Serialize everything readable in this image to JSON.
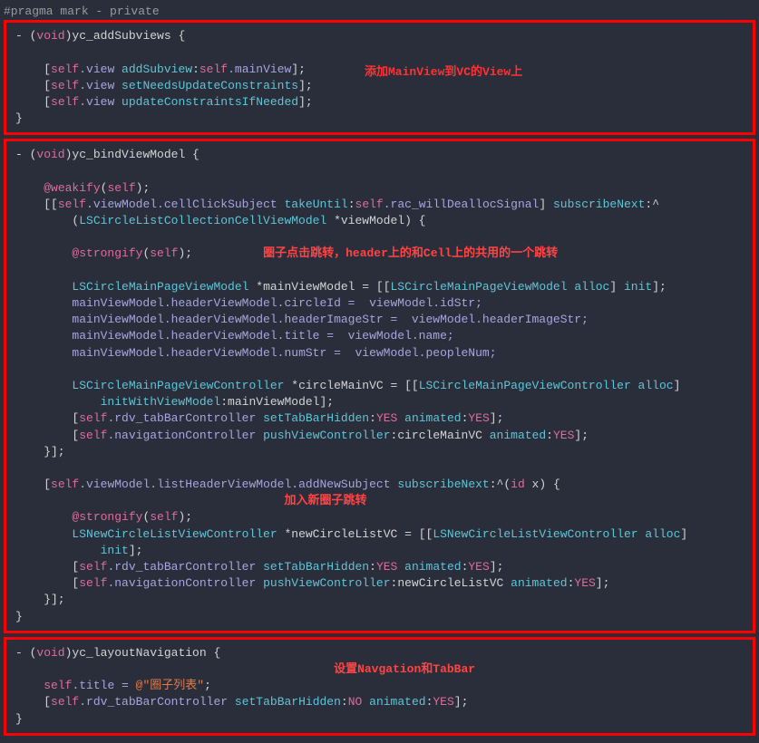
{
  "pragma": "#pragma mark - private",
  "section1": {
    "sig": "- (void)yc_addSubviews {",
    "l1_a": "self",
    "l1_b": ".view ",
    "l1_c": "addSubview",
    "l1_d": ":",
    "l1_e": "self",
    "l1_f": ".mainView",
    "l1_g": "];",
    "l2_a": "self",
    "l2_b": ".view ",
    "l2_c": "setNeedsUpdateConstraints",
    "l2_d": "];",
    "l3_a": "self",
    "l3_b": ".view ",
    "l3_c": "updateConstraintsIfNeeded",
    "l3_d": "];",
    "close": "}",
    "annotation": "添加MainView到VC的View上"
  },
  "section2": {
    "sig": "- (void)yc_bindViewModel {",
    "weak_a": "@weakify",
    "weak_b": "(",
    "weak_c": "self",
    "weak_d": ");",
    "sub1_a": "[[",
    "sub1_b": "self",
    "sub1_c": ".viewModel.cellClickSubject ",
    "sub1_d": "takeUntil",
    "sub1_e": ":",
    "sub1_f": "self",
    "sub1_g": ".rac_willDeallocSignal",
    "sub1_h": "] ",
    "sub1_i": "subscribeNext",
    "sub1_j": ":^",
    "sub1_k": "        (",
    "sub1_l": "LSCircleListCollectionCellViewModel",
    "sub1_m": " *viewModel) {",
    "strong1_a": "@strongify",
    "strong1_b": "(",
    "strong1_c": "self",
    "strong1_d": ");",
    "ann1": "圈子点击跳转，header上的和Cell上的共用的一个跳转",
    "m1_a": "LSCircleMainPageViewModel",
    "m1_b": " *mainViewModel = [[",
    "m1_c": "LSCircleMainPageViewModel",
    "m1_d": " alloc",
    "m1_e": "] ",
    "m1_f": "init",
    "m1_g": "];",
    "m2_a": "mainViewModel.headerViewModel.circleId =  viewModel.idStr;",
    "m3_a": "mainViewModel.headerViewModel.headerImageStr =  viewModel.headerImageStr;",
    "m4_a": "mainViewModel.headerViewModel.title =  viewModel.name;",
    "m5_a": "mainViewModel.headerViewModel.numStr =  viewModel.peopleNum;",
    "c1_a": "LSCircleMainPageViewController",
    "c1_b": " *circleMainVC = [[",
    "c1_c": "LSCircleMainPageViewController",
    "c1_d": " alloc",
    "c1_e": "]",
    "c1_f": "            initWithViewModel",
    "c1_g": ":mainViewModel];",
    "t1_a": "[",
    "t1_b": "self",
    "t1_c": ".rdv_tabBarController ",
    "t1_d": "setTabBarHidden",
    "t1_e": ":",
    "t1_f": "YES",
    "t1_g": " animated",
    "t1_h": ":",
    "t1_i": "YES",
    "t1_j": "];",
    "n1_a": "[",
    "n1_b": "self",
    "n1_c": ".navigationController ",
    "n1_d": "pushViewController",
    "n1_e": ":circleMainVC ",
    "n1_f": "animated",
    "n1_g": ":",
    "n1_h": "YES",
    "n1_i": "];",
    "close1": "    }];",
    "sub2_a": "[",
    "sub2_b": "self",
    "sub2_c": ".viewModel.listHeaderViewModel.addNewSubject ",
    "sub2_d": "subscribeNext",
    "sub2_e": ":^(",
    "sub2_f": "id",
    "sub2_g": " x) {",
    "ann2": "加入新圈子跳转",
    "strong2_a": "@strongify",
    "strong2_b": "(",
    "strong2_c": "self",
    "strong2_d": ");",
    "nc_a": "LSNewCircleListViewController",
    "nc_b": " *newCircleListVC = [[",
    "nc_c": "LSNewCircleListViewController",
    "nc_d": " alloc",
    "nc_e": "]",
    "nc_f": "            init",
    "nc_g": "];",
    "t2_a": "[",
    "t2_b": "self",
    "t2_c": ".rdv_tabBarController ",
    "t2_d": "setTabBarHidden",
    "t2_e": ":",
    "t2_f": "YES",
    "t2_g": " animated",
    "t2_h": ":",
    "t2_i": "YES",
    "t2_j": "];",
    "n2_a": "[",
    "n2_b": "self",
    "n2_c": ".navigationController ",
    "n2_d": "pushViewController",
    "n2_e": ":newCircleListVC ",
    "n2_f": "animated",
    "n2_g": ":",
    "n2_h": "YES",
    "n2_i": "];",
    "close2": "    }];",
    "close": "}"
  },
  "section3": {
    "sig": "- (void)yc_layoutNavigation {",
    "ann": "设置Navgation和TabBar",
    "t_a": "self",
    "t_b": ".title = ",
    "t_c": "@\"圈子列表\"",
    "t_d": ";",
    "tb_a": "[",
    "tb_b": "self",
    "tb_c": ".rdv_tabBarController ",
    "tb_d": "setTabBarHidden",
    "tb_e": ":",
    "tb_f": "NO",
    "tb_g": " animated",
    "tb_h": ":",
    "tb_i": "YES",
    "tb_j": "];",
    "close": "}"
  }
}
